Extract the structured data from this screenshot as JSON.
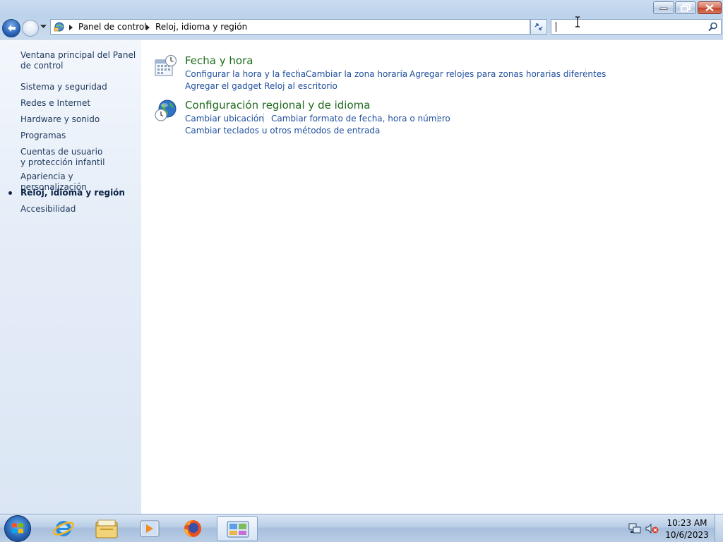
{
  "window": {
    "min_label": "",
    "max_label": "",
    "close_label": ""
  },
  "navbar": {
    "breadcrumb": [
      "Panel de control",
      "Reloj, idioma y región"
    ],
    "search": {
      "value": "",
      "placeholder": ""
    }
  },
  "sidebar": {
    "items": [
      "Ventana principal del Panel de control",
      "Sistema y seguridad",
      "Redes e Internet",
      "Hardware y sonido",
      "Programas",
      "Cuentas de usuario y protección infantil",
      "Apariencia y personalización",
      "Reloj, idioma y región",
      "Accesibilidad"
    ],
    "active_index": 7
  },
  "main": {
    "categories": [
      {
        "title": "Fecha y hora",
        "icon": "clock-calendar-icon",
        "tasks": [
          "Configurar la hora y la fecha",
          "Cambiar la zona horaria",
          "Agregar relojes para zonas horarias diferentes",
          "Agregar el gadget Reloj al escritorio"
        ]
      },
      {
        "title": "Configuración regional y de idioma",
        "icon": "globe-clock-icon",
        "tasks": [
          "Cambiar ubicación",
          "Cambiar formato de fecha, hora o número",
          "Cambiar teclados u otros métodos de entrada"
        ]
      }
    ]
  },
  "taskbar": {
    "apps": [
      "internet-explorer-icon",
      "file-explorer-icon",
      "media-player-icon",
      "firefox-icon",
      "control-panel-icon"
    ],
    "clock": {
      "time": "10:23 AM",
      "date": "10/6/2023"
    }
  },
  "colors": {
    "link": "#1f4f9c",
    "category_title": "#1e6b1e",
    "sidebar_text": "#1e395b"
  }
}
